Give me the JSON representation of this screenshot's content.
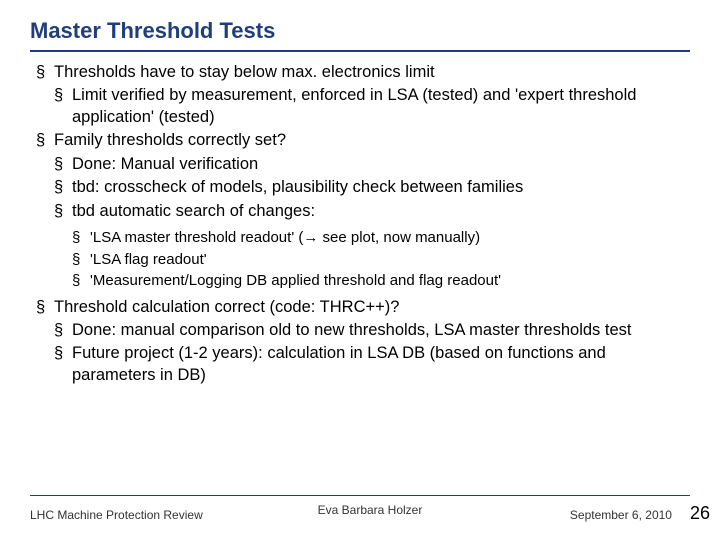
{
  "title": "Master Threshold Tests",
  "bullets": {
    "b1": "Thresholds have to stay below max. electronics limit",
    "b1a": "Limit verified by measurement, enforced in LSA (tested) and 'expert threshold application' (tested)",
    "b2": "Family thresholds correctly set?",
    "b2a": "Done: Manual verification",
    "b2b": "tbd: crosscheck of models, plausibility check between families",
    "b2c": "tbd automatic search of changes:",
    "b2c1": "'LSA master threshold readout' (→ see plot, now manually)",
    "b2c2": "'LSA flag readout'",
    "b2c3": "'Measurement/Logging DB applied threshold and flag readout'",
    "b3": "Threshold calculation correct (code: THRC++)?",
    "b3a": "Done: manual comparison old to new thresholds, LSA master thresholds test",
    "b3b": "Future project (1-2 years): calculation in LSA DB (based on functions and parameters in DB)"
  },
  "footer": {
    "left": "LHC Machine Protection Review",
    "center": "Eva Barbara Holzer",
    "right": "September 6, 2010",
    "page": "26"
  }
}
